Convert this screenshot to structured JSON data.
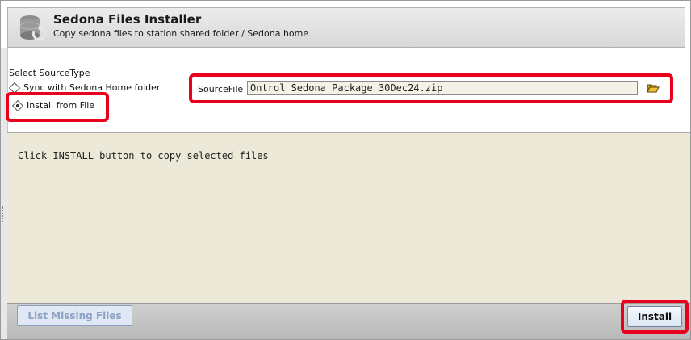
{
  "header": {
    "title": "Sedona Files Installer",
    "subtitle": "Copy sedona files to station shared folder / Sedona home"
  },
  "source_type": {
    "label": "Select SourceType",
    "options": [
      {
        "label": "Sync with Sedona Home folder",
        "selected": false
      },
      {
        "label": "Install from File",
        "selected": true
      }
    ]
  },
  "source_file": {
    "label": "SourceFile",
    "value": "Ontrol Sedona Package 30Dec24.zip"
  },
  "log": {
    "text": "Click INSTALL button to copy selected files"
  },
  "buttons": {
    "list_missing": "List Missing Files",
    "install": "Install"
  },
  "colors": {
    "highlight": "#e8001c",
    "log_background": "#ece9d8"
  }
}
